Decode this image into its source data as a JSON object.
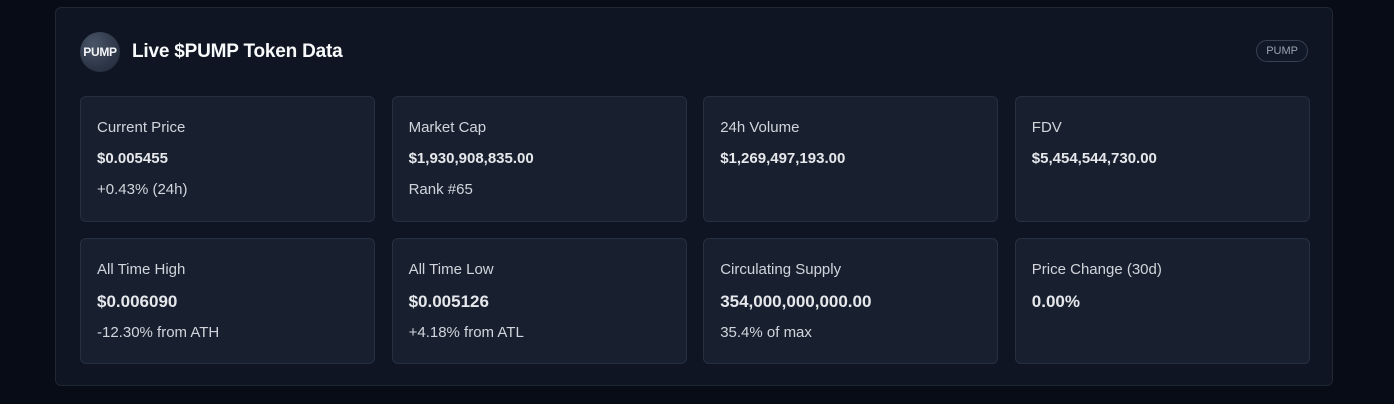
{
  "header": {
    "logo_text": "PUMP",
    "title": "Live $PUMP Token Data",
    "badge": "PUMP"
  },
  "cards": [
    {
      "label": "Current Price",
      "value": "$0.005455",
      "sub": "+0.43% (24h)"
    },
    {
      "label": "Market Cap",
      "value": "$1,930,908,835.00",
      "sub": "Rank #65"
    },
    {
      "label": "24h Volume",
      "value": "$1,269,497,193.00",
      "sub": ""
    },
    {
      "label": "FDV",
      "value": "$5,454,544,730.00",
      "sub": ""
    },
    {
      "label": "All Time High",
      "value": "$0.006090",
      "sub": "-12.30% from ATH"
    },
    {
      "label": "All Time Low",
      "value": "$0.005126",
      "sub": "+4.18% from ATL"
    },
    {
      "label": "Circulating Supply",
      "value": "354,000,000,000.00",
      "sub": "35.4% of max"
    },
    {
      "label": "Price Change (30d)",
      "value": "0.00%",
      "sub": ""
    }
  ]
}
